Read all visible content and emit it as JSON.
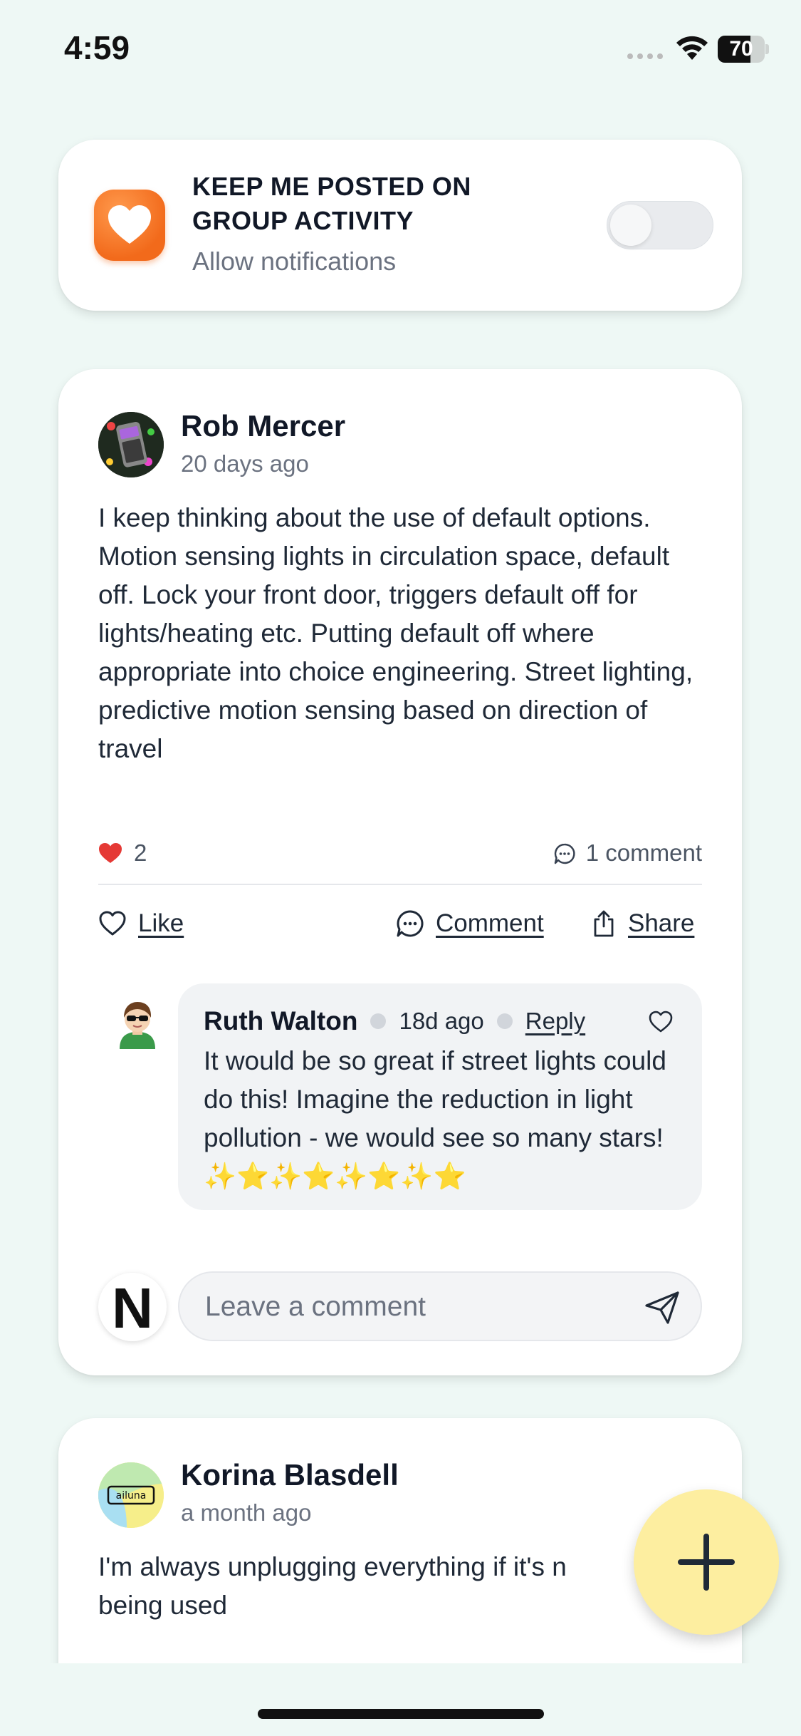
{
  "status_bar": {
    "time": "4:59",
    "battery": "70",
    "battery_level_percent": 70
  },
  "notifications": {
    "title": "KEEP ME POSTED ON GROUP ACTIVITY",
    "subtitle": "Allow notifications",
    "toggle_on": false
  },
  "post": {
    "author": "Rob Mercer",
    "time": "20 days ago",
    "body": "I keep thinking about the use of default options. Motion sensing lights in circulation space, default off. Lock your front door, triggers default off for lights/heating etc. Putting default off where appropriate into choice engineering.  Street lighting, predictive motion sensing based on direction of travel",
    "likes": "2",
    "comment_count": "1 comment",
    "actions": {
      "like": "Like",
      "comment": "Comment",
      "share": "Share"
    },
    "reply": {
      "author": "Ruth Walton",
      "time": "18d ago",
      "reply_label": "Reply",
      "text": "It would be so great if street lights could do this! Imagine the reduction in light pollution - we would see so many stars! ✨⭐✨⭐✨⭐✨⭐"
    },
    "composer": {
      "avatar_letter": "N",
      "placeholder": "Leave a comment"
    }
  },
  "post2": {
    "author": "Korina Blasdell",
    "time": "a month ago",
    "body": "I'm always unplugging everything if it's n being used",
    "avatar_text": "ailuna"
  },
  "colors": {
    "background": "#eef8f5",
    "fab": "#fdeea0",
    "heart": "#e53935",
    "notify_icon": "#f26a1b"
  },
  "icons": [
    "signal-icon",
    "wifi-icon",
    "battery-icon",
    "heart-app-icon",
    "heart-filled-icon",
    "comment-icon",
    "heart-outline-icon",
    "share-icon",
    "send-icon",
    "plus-icon"
  ]
}
